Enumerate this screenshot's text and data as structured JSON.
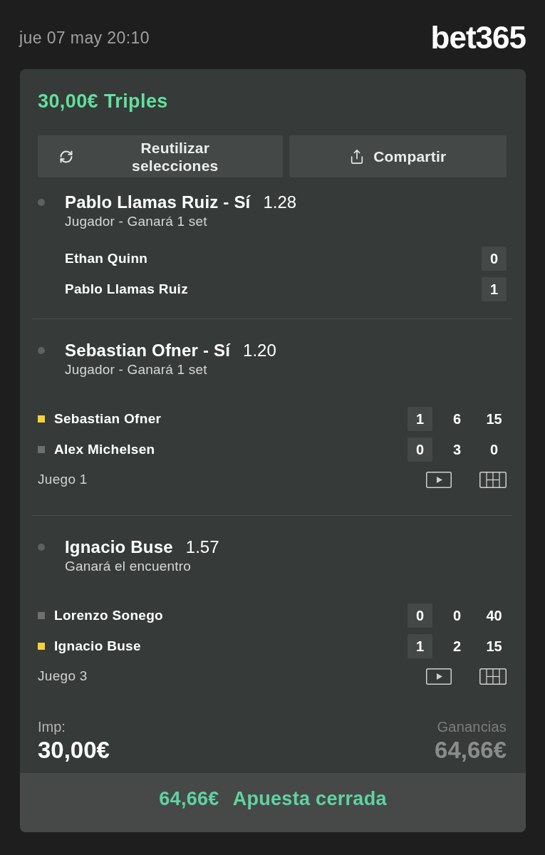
{
  "header": {
    "date": "jue 07 may 20:10",
    "logo": "bet365"
  },
  "bet": {
    "title": "30,00€ Triples",
    "buttons": [
      {
        "label": "Reutilizar selecciones",
        "kind": "reuse"
      },
      {
        "label": "Compartir",
        "kind": "share"
      }
    ],
    "selections": [
      {
        "name": "Pablo Llamas Ruiz - Sí",
        "odds": "1.28",
        "market": "Jugador - Ganará 1 set",
        "players": [
          {
            "name": "Ethan Quinn",
            "scores": [
              "0"
            ]
          },
          {
            "name": "Pablo Llamas Ruiz",
            "scores": [
              "1"
            ]
          }
        ]
      },
      {
        "name": "Sebastian Ofner - Sí",
        "odds": "1.20",
        "market": "Jugador - Ganará 1 set",
        "players": [
          {
            "name": "Sebastian Ofner",
            "color": "#f2d33a",
            "scores": [
              "1",
              "6",
              "15"
            ]
          },
          {
            "name": "Alex Michelsen",
            "color": "#6e6f6e",
            "scores": [
              "0",
              "3",
              "0"
            ]
          }
        ],
        "game": "Juego 1"
      },
      {
        "name": "Ignacio Buse",
        "odds": "1.57",
        "market": "Ganará el encuentro",
        "players": [
          {
            "name": "Lorenzo Sonego",
            "color": "#6e6f6e",
            "scores": [
              "0",
              "0",
              "40"
            ]
          },
          {
            "name": "Ignacio Buse",
            "color": "#f2d33a",
            "scores": [
              "1",
              "2",
              "15"
            ]
          }
        ],
        "game": "Juego 3"
      }
    ],
    "stake": {
      "label": "Imp:",
      "value": "30,00€"
    },
    "returns": {
      "label": "Ganancias",
      "value": "64,66€"
    },
    "status": {
      "amount": "64,66€",
      "label": "Apuesta cerrada"
    }
  }
}
